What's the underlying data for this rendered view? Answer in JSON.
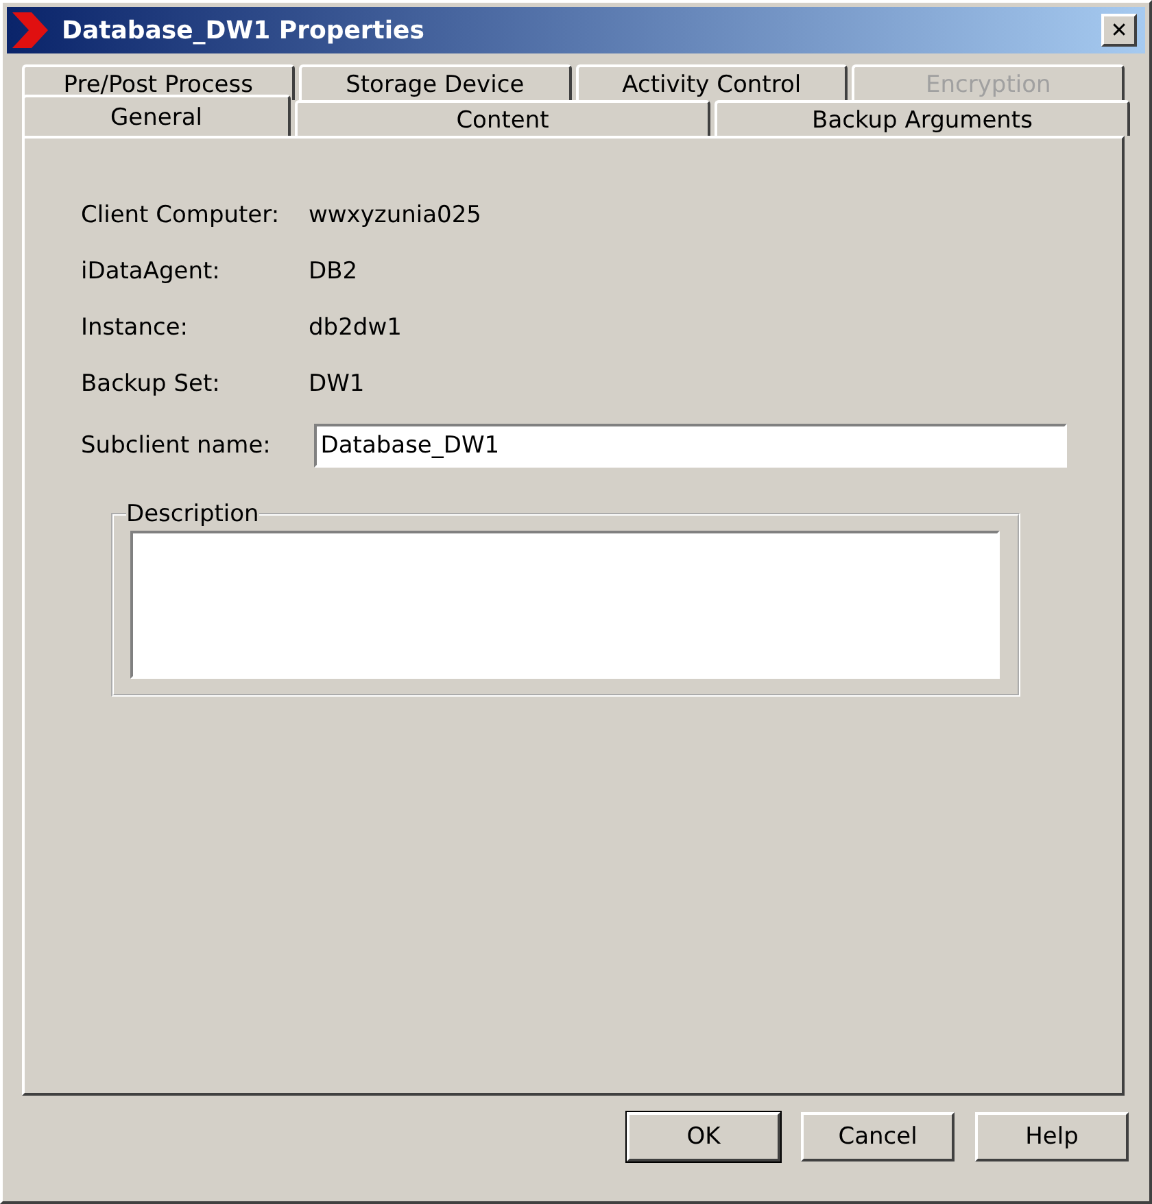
{
  "window": {
    "title": "Database_DW1 Properties",
    "close": "✕"
  },
  "tab_rows": [
    {
      "tabs": [
        {
          "label": "Pre/Post Process",
          "selected": false,
          "disabled": false
        },
        {
          "label": "Storage Device",
          "selected": false,
          "disabled": false
        },
        {
          "label": "Activity Control",
          "selected": false,
          "disabled": false
        },
        {
          "label": "Encryption",
          "selected": false,
          "disabled": true
        }
      ]
    },
    {
      "tabs": [
        {
          "label": "General",
          "selected": true,
          "disabled": false
        },
        {
          "label": "Content",
          "selected": false,
          "disabled": false
        },
        {
          "label": "Backup Arguments",
          "selected": false,
          "disabled": false
        }
      ]
    }
  ],
  "info": [
    {
      "label": "Client Computer:",
      "value": "wwxyzunia025"
    },
    {
      "label": "iDataAgent:",
      "value": "DB2"
    },
    {
      "label": "Instance:",
      "value": "db2dw1"
    },
    {
      "label": "Backup Set:",
      "value": "DW1"
    }
  ],
  "subclient_name": {
    "label": "Subclient name:",
    "value": "Database_DW1"
  },
  "description": {
    "label": "Description"
  },
  "buttons": [
    {
      "label": "OK",
      "default": true
    },
    {
      "label": "Cancel",
      "default": false
    },
    {
      "label": "Help",
      "default": false
    }
  ]
}
